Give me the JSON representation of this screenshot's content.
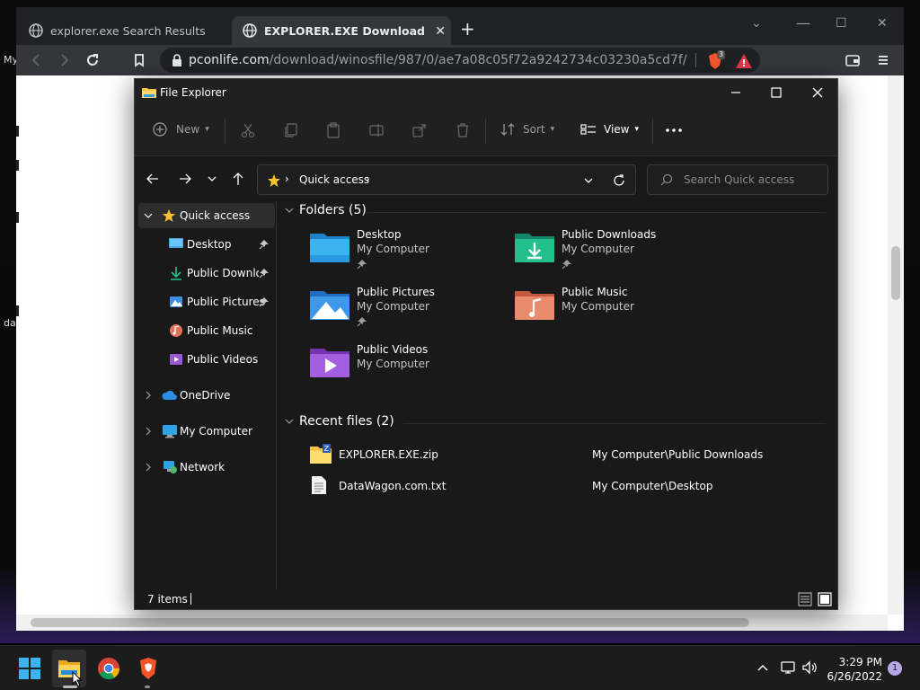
{
  "desktop": {
    "fragments": [
      "My",
      "da"
    ]
  },
  "browser": {
    "tabs": [
      {
        "title": "explorer.exe Search Results",
        "active": false
      },
      {
        "title": "EXPLORER.EXE Download & Fix For",
        "active": true
      }
    ],
    "url_host": "pconlife.com",
    "url_path": "/download/winosfile/987/0/ae7a08c05f72a9242734c03230a5cd7f/",
    "brave_badge": "3",
    "accent": "#fb542b"
  },
  "explorer": {
    "title": "File Explorer",
    "commands": {
      "new": "New",
      "sort": "Sort",
      "view": "View"
    },
    "address": {
      "crumb": "Quick access"
    },
    "search": {
      "placeholder": "Search Quick access"
    },
    "nav": {
      "quick_access": "Quick access",
      "desktop": "Desktop",
      "public_downloads": "Public Downloads",
      "public_pictures": "Public Pictures",
      "public_music": "Public Music",
      "public_videos": "Public Videos",
      "onedrive": "OneDrive",
      "my_computer": "My Computer",
      "network": "Network"
    },
    "folders_header": "Folders (5)",
    "folders": [
      {
        "name": "Desktop",
        "location": "My Computer",
        "pinned": true
      },
      {
        "name": "Public Downloads",
        "location": "My Computer",
        "pinned": true
      },
      {
        "name": "Public Pictures",
        "location": "My Computer",
        "pinned": true
      },
      {
        "name": "Public Music",
        "location": "My Computer",
        "pinned": false
      },
      {
        "name": "Public Videos",
        "location": "My Computer",
        "pinned": false
      }
    ],
    "recent_header": "Recent files (2)",
    "recent": [
      {
        "name": "EXPLORER.EXE.zip",
        "location": "My Computer\\Public Downloads"
      },
      {
        "name": "DataWagon.com.txt",
        "location": "My Computer\\Desktop"
      }
    ],
    "status": {
      "items": "7 items"
    }
  },
  "taskbar": {
    "time": "3:29 PM",
    "date": "6/26/2022",
    "notifications": "1"
  }
}
